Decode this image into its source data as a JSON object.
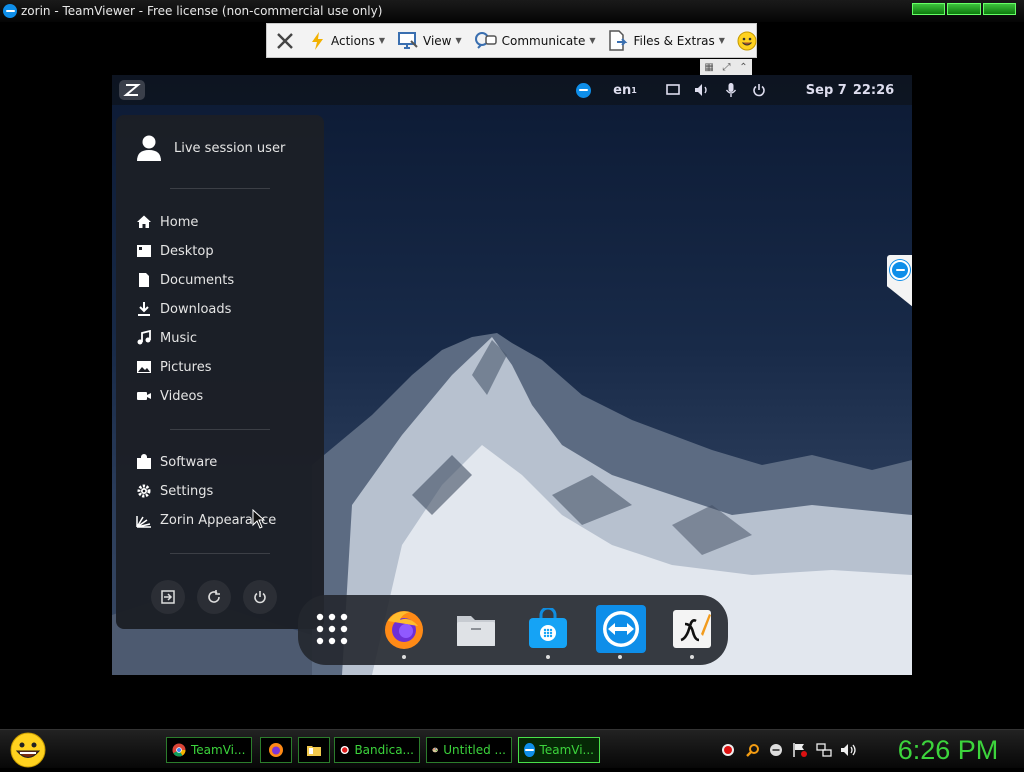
{
  "window": {
    "title": "zorin - TeamViewer - Free license (non-commercial use only)"
  },
  "toolbar": {
    "close_icon": "close-x-icon",
    "actions_label": "Actions",
    "view_label": "View",
    "communicate_label": "Communicate",
    "files_label": "Files & Extras"
  },
  "remote": {
    "topbar": {
      "keyboard_layout": "en",
      "keyboard_sub": "1",
      "date": "Sep 7",
      "time": "22:26"
    },
    "user_menu": {
      "user_name": "Live session user",
      "places": [
        {
          "label": "Home",
          "icon": "home-icon"
        },
        {
          "label": "Desktop",
          "icon": "desktop-icon"
        },
        {
          "label": "Documents",
          "icon": "documents-icon"
        },
        {
          "label": "Downloads",
          "icon": "downloads-icon"
        },
        {
          "label": "Music",
          "icon": "music-icon"
        },
        {
          "label": "Pictures",
          "icon": "pictures-icon"
        },
        {
          "label": "Videos",
          "icon": "videos-icon"
        }
      ],
      "apps": [
        {
          "label": "Software",
          "icon": "software-icon"
        },
        {
          "label": "Settings",
          "icon": "settings-icon"
        },
        {
          "label": "Zorin Appearance",
          "icon": "appearance-icon"
        }
      ]
    },
    "dock": [
      {
        "name": "app-grid",
        "running": false
      },
      {
        "name": "firefox",
        "running": true
      },
      {
        "name": "files",
        "running": false
      },
      {
        "name": "software-store",
        "running": true
      },
      {
        "name": "teamviewer",
        "running": true
      },
      {
        "name": "xournal",
        "running": true
      }
    ]
  },
  "taskbar": {
    "buttons": [
      {
        "label": "TeamVi...",
        "icon": "chrome-icon"
      },
      {
        "label": "",
        "icon": "firefox-icon"
      },
      {
        "label": "",
        "icon": "folder-icon"
      },
      {
        "label": "Bandica...",
        "icon": "bandicam-icon"
      },
      {
        "label": "Untitled ...",
        "icon": "paint-icon"
      },
      {
        "label": "TeamVi...",
        "icon": "teamviewer-icon"
      }
    ],
    "clock": "6:26 PM"
  },
  "colors": {
    "taskbar_green": "#3cd43c",
    "teamviewer_blue": "#0e8ee9",
    "menu_bg": "#1c1f26"
  }
}
